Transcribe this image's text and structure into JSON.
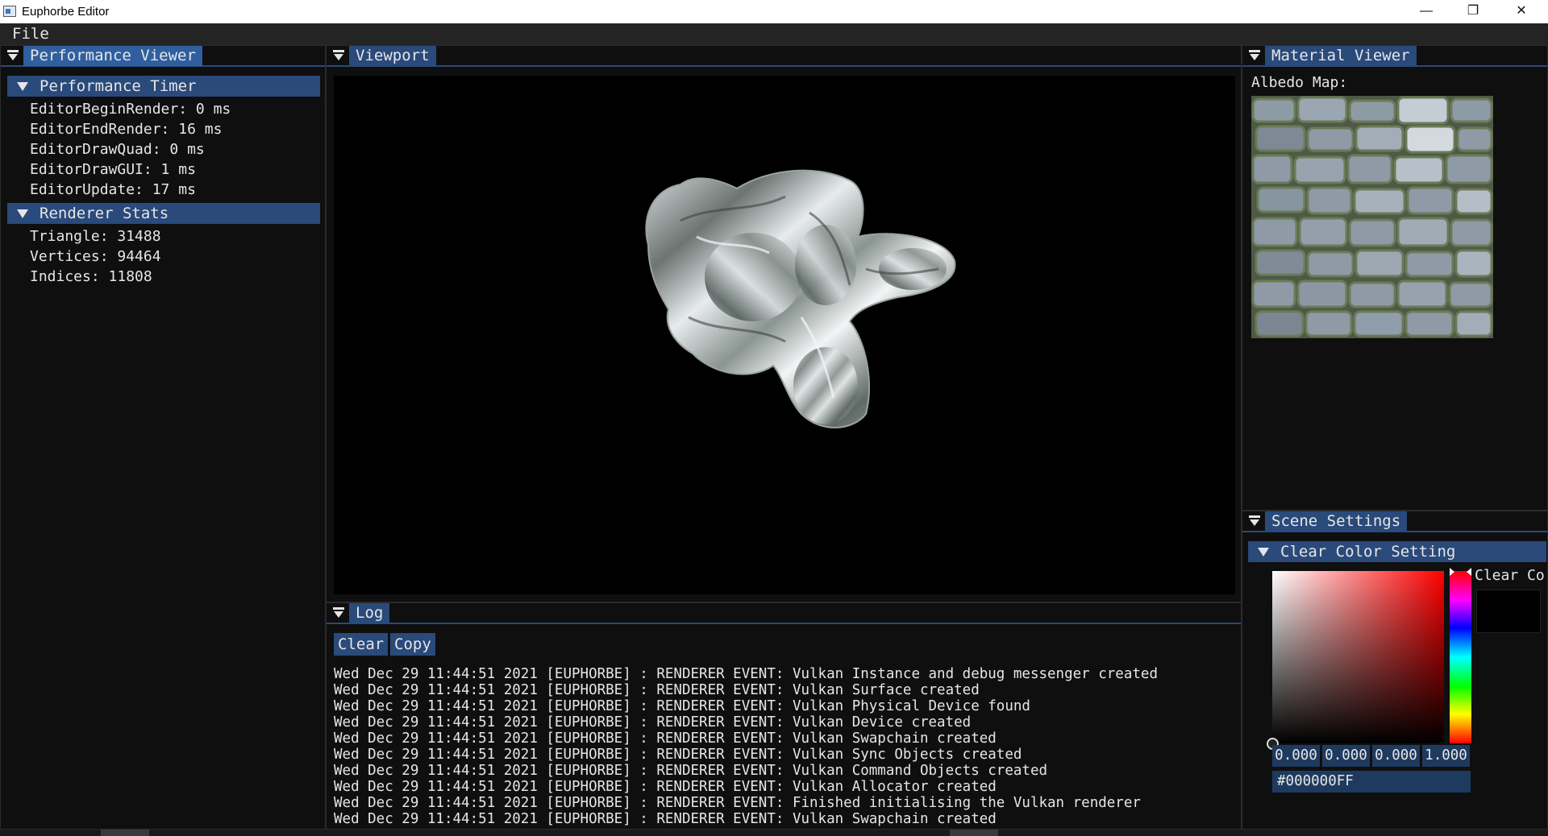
{
  "window": {
    "title": "Euphorbe Editor",
    "controls": {
      "minimize": "—",
      "maximize": "❐",
      "close": "✕"
    }
  },
  "menu": {
    "file": "File"
  },
  "performance_viewer": {
    "tab": "Performance Viewer",
    "timer_header": "Performance Timer",
    "timers": [
      "EditorBeginRender: 0 ms",
      "EditorEndRender: 16 ms",
      "EditorDrawQuad: 0 ms",
      "EditorDrawGUI: 1 ms",
      "EditorUpdate: 17 ms"
    ],
    "stats_header": "Renderer Stats",
    "stats": [
      "Triangle: 31488",
      "Vertices: 94464",
      "Indices: 11808"
    ]
  },
  "viewport": {
    "tab": "Viewport"
  },
  "log": {
    "tab": "Log",
    "clear_label": "Clear",
    "copy_label": "Copy",
    "lines": [
      "Wed Dec 29 11:44:51 2021 [EUPHORBE] : RENDERER EVENT: Vulkan Instance and debug messenger created",
      "Wed Dec 29 11:44:51 2021 [EUPHORBE] : RENDERER EVENT: Vulkan Surface created",
      "Wed Dec 29 11:44:51 2021 [EUPHORBE] : RENDERER EVENT: Vulkan Physical Device found",
      "Wed Dec 29 11:44:51 2021 [EUPHORBE] : RENDERER EVENT: Vulkan Device created",
      "Wed Dec 29 11:44:51 2021 [EUPHORBE] : RENDERER EVENT: Vulkan Swapchain created",
      "Wed Dec 29 11:44:51 2021 [EUPHORBE] : RENDERER EVENT: Vulkan Sync Objects created",
      "Wed Dec 29 11:44:51 2021 [EUPHORBE] : RENDERER EVENT: Vulkan Command Objects created",
      "Wed Dec 29 11:44:51 2021 [EUPHORBE] : RENDERER EVENT: Vulkan Allocator created",
      "Wed Dec 29 11:44:51 2021 [EUPHORBE] : RENDERER EVENT: Finished initialising the Vulkan renderer",
      "Wed Dec 29 11:44:51 2021 [EUPHORBE] : RENDERER EVENT: Vulkan Swapchain created"
    ]
  },
  "material_viewer": {
    "tab": "Material Viewer",
    "albedo_label": "Albedo Map:"
  },
  "scene_settings": {
    "tab": "Scene Settings",
    "clear_color_header": "Clear Color Setting",
    "preview_label": "Clear Co",
    "rgba": [
      "0.000",
      "0.000",
      "0.000",
      "1.000"
    ],
    "hex": "#000000FF"
  },
  "colors": {
    "accent": "#294a7a",
    "active_tab": "#2f5f9f",
    "background": "#0f0f0f",
    "field": "#1e3a5f"
  }
}
